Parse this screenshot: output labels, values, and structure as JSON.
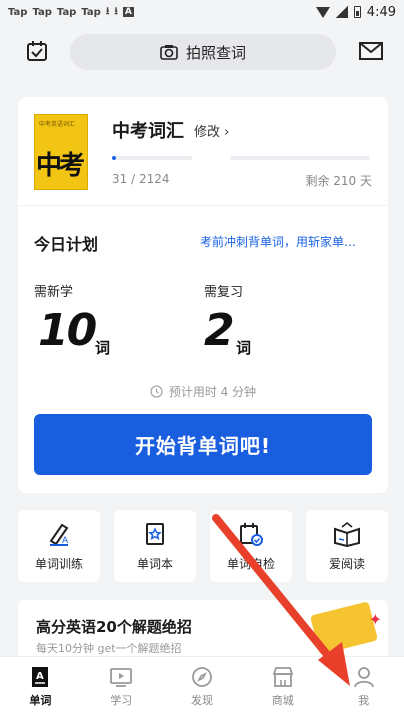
{
  "status_bar": {
    "left_items": [
      "Tap",
      "Tap",
      "Tap",
      "Tap"
    ],
    "time": "4:49"
  },
  "header": {
    "search_label": "拍照查词"
  },
  "book": {
    "cover_small": "中考英语词汇",
    "cover_big": "中考",
    "title": "中考词汇",
    "edit_label": "修改 ›",
    "learned": 31,
    "total": 2124,
    "count_text": "31 / 2124",
    "remaining_text": "剩余 210 天"
  },
  "plan": {
    "title": "今日计划",
    "tip": "考前冲刺背单词，用斩家单…",
    "new_label": "需新学",
    "new_count": "10",
    "new_unit": "词",
    "review_label": "需复习",
    "review_count": "2",
    "review_unit": "词",
    "estimate": "预计用时 4 分钟",
    "start_button": "开始背单词吧!"
  },
  "tiles": [
    {
      "label": "单词训练",
      "icon": "pen-icon"
    },
    {
      "label": "单词本",
      "icon": "bookmark-star-icon"
    },
    {
      "label": "单词自检",
      "icon": "calendar-check-icon"
    },
    {
      "label": "爱阅读",
      "icon": "open-book-icon"
    }
  ],
  "banner": {
    "headline": "高分英语20个解题绝招",
    "subline": "每天10分钟 get一个解题绝招"
  },
  "bottom_nav": [
    {
      "label": "单词",
      "icon": "word-book-icon",
      "active": true
    },
    {
      "label": "学习",
      "icon": "play-screen-icon",
      "active": false
    },
    {
      "label": "发现",
      "icon": "compass-icon",
      "active": false
    },
    {
      "label": "商城",
      "icon": "store-icon",
      "active": false
    },
    {
      "label": "我",
      "icon": "person-icon",
      "active": false
    }
  ],
  "colors": {
    "accent": "#1a5ee0",
    "annotation_arrow": "#e8402a"
  }
}
